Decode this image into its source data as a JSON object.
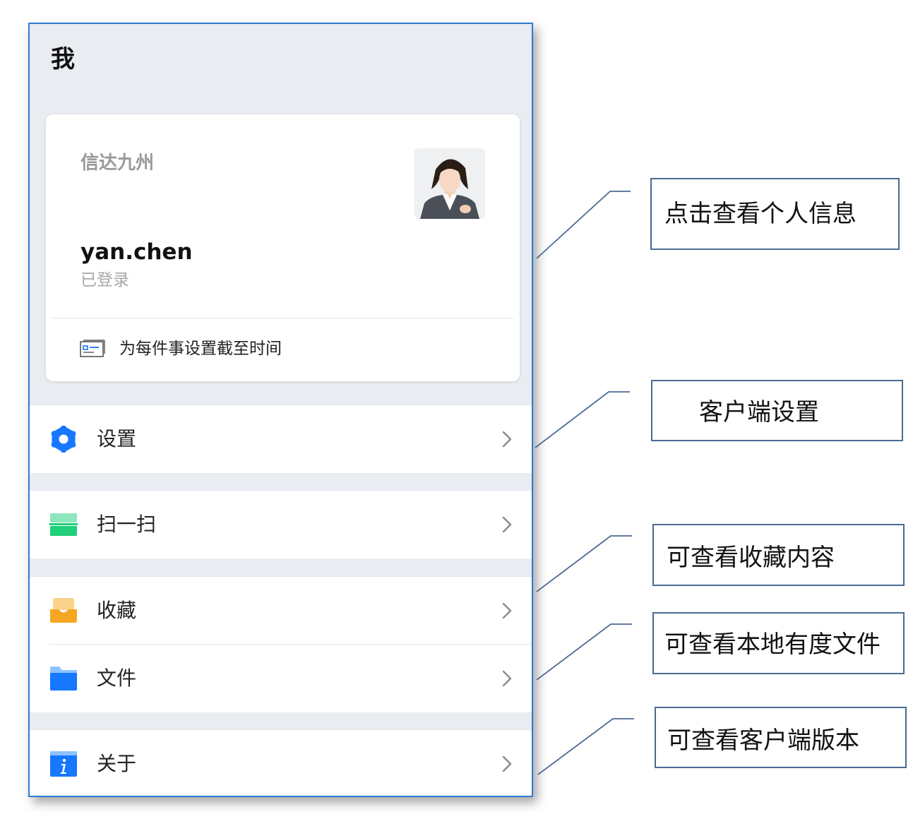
{
  "screen": {
    "title": "我"
  },
  "profile": {
    "organization": "信达九州",
    "username": "yan.chen",
    "status": "已登录",
    "avatar_icon": "user-photo-avatar",
    "deadline_icon": "id-card-icon",
    "deadline_text": "为每件事设置截至时间"
  },
  "menu": {
    "settings": {
      "label": "设置",
      "icon": "gear-icon",
      "color": "#1677ff"
    },
    "scan": {
      "label": "扫一扫",
      "icon": "scan-icon",
      "color": "#1fcf7a"
    },
    "favorites": {
      "label": "收藏",
      "icon": "favorites-tray-icon",
      "color": "#f5a623"
    },
    "files": {
      "label": "文件",
      "icon": "folder-icon",
      "color": "#1677ff"
    },
    "about": {
      "label": "关于",
      "icon": "info-icon",
      "color": "#1677ff"
    }
  },
  "callouts": {
    "personal_info": "点击查看个人信息",
    "client_settings": "客户端设置",
    "favorites": "可查看收藏内容",
    "local_files": "可查看本地有度文件",
    "client_version": "可查看客户端版本"
  },
  "colors": {
    "accent_blue": "#1677ff",
    "frame_border": "#2d7bd6",
    "callout_border": "#4a6a92",
    "background_gray": "#e9ecf0"
  }
}
